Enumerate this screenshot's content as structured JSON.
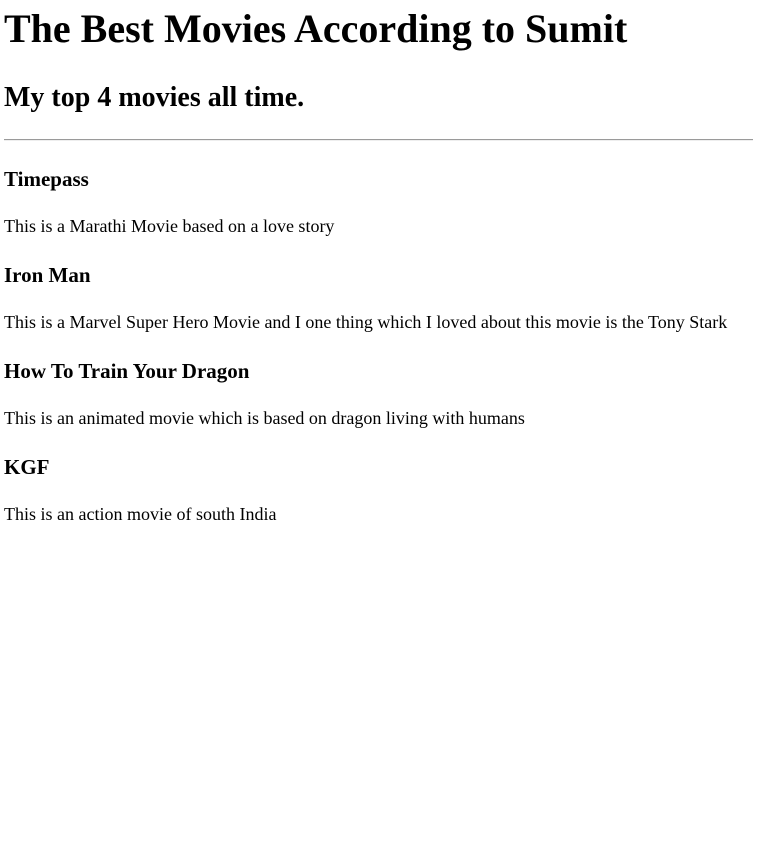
{
  "page": {
    "title": "The Best Movies According to Sumit",
    "subtitle": "My top 4 movies all time."
  },
  "movies": [
    {
      "name": "Timepass",
      "description": "This is a Marathi Movie based on a love story"
    },
    {
      "name": "Iron Man",
      "description": "This is a Marvel Super Hero Movie and I one thing which I loved about this movie is the Tony Stark"
    },
    {
      "name": "How To Train Your Dragon",
      "description": "This is an animated movie which is based on dragon living with humans"
    },
    {
      "name": "KGF",
      "description": "This is an action movie of south India"
    }
  ]
}
